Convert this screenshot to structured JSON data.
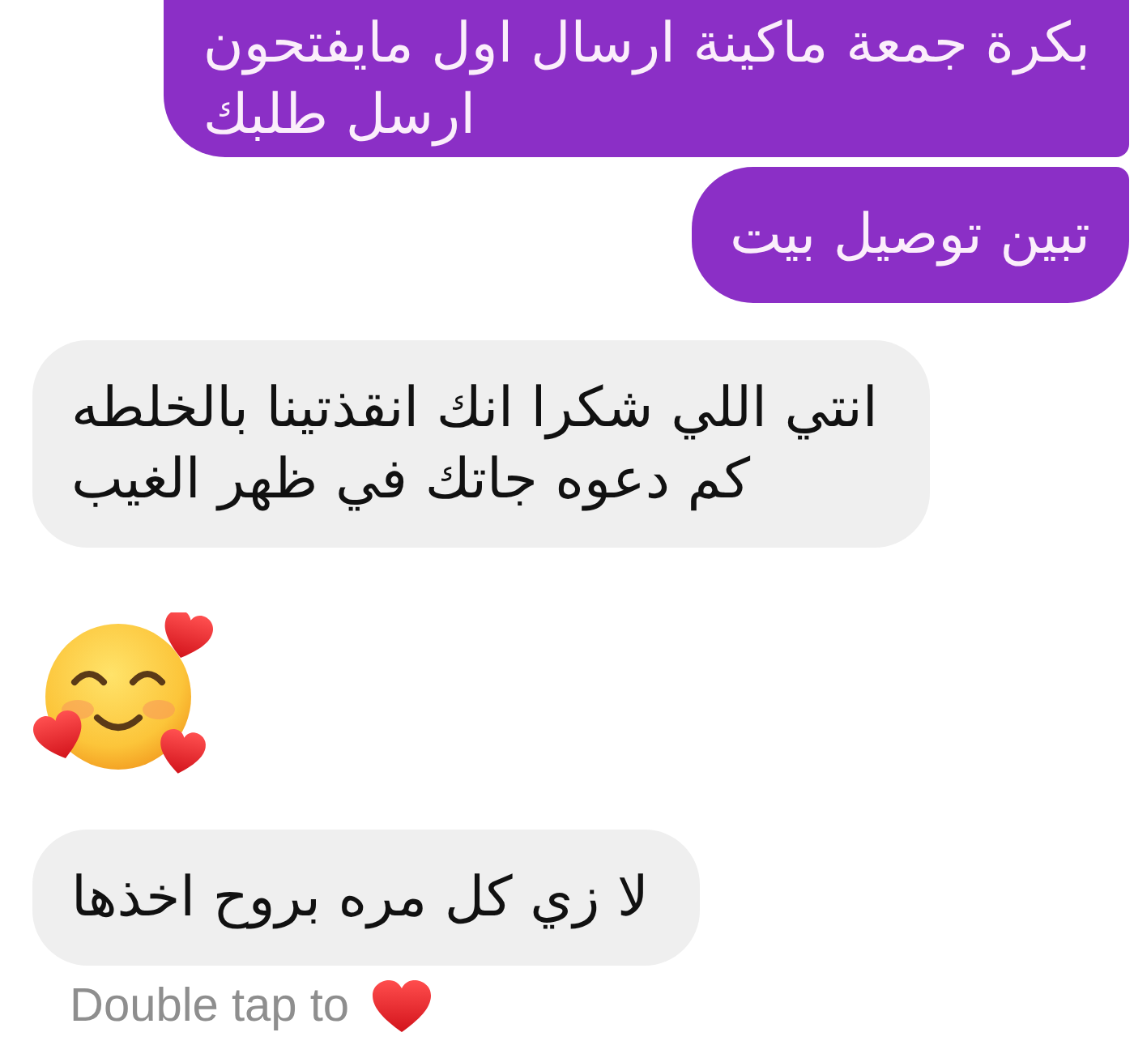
{
  "messages": [
    {
      "outgoing": true,
      "kind": "text",
      "text": "بكرة جمعة ماكينة ارسال اول مايفتحون\nارسل طلبك"
    },
    {
      "outgoing": true,
      "kind": "text",
      "text": "تبين توصيل بيت"
    },
    {
      "outgoing": false,
      "kind": "text",
      "text": "انتي اللي شكرا انك انقذتينا بالخلطه\nكم دعوه جاتك في ظهر الغيب"
    },
    {
      "outgoing": false,
      "kind": "emoji"
    },
    {
      "outgoing": false,
      "kind": "text",
      "text": "لا زي كل مره بروح اخذها"
    }
  ],
  "reaction_hint": {
    "text": "Double tap to"
  }
}
